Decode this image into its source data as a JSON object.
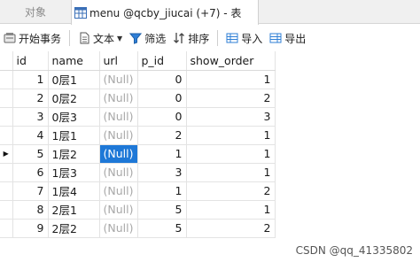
{
  "tabs": {
    "inactive_label": "对象",
    "active_label": "menu @qcby_jiucai (+7) - 表"
  },
  "toolbar": {
    "begin_transaction": "开始事务",
    "text": "文本",
    "filter": "筛选",
    "sort": "排序",
    "import": "导入",
    "export": "导出"
  },
  "columns": [
    "id",
    "name",
    "url",
    "p_id",
    "show_order"
  ],
  "rows": [
    {
      "id": "1",
      "name": "0层1",
      "url": "(Null)",
      "p_id": "0",
      "show_order": "1"
    },
    {
      "id": "2",
      "name": "0层2",
      "url": "(Null)",
      "p_id": "0",
      "show_order": "2"
    },
    {
      "id": "3",
      "name": "0层3",
      "url": "(Null)",
      "p_id": "0",
      "show_order": "3"
    },
    {
      "id": "4",
      "name": "1层1",
      "url": "(Null)",
      "p_id": "2",
      "show_order": "1"
    },
    {
      "id": "5",
      "name": "1层2",
      "url": "(Null)",
      "p_id": "1",
      "show_order": "1"
    },
    {
      "id": "6",
      "name": "1层3",
      "url": "(Null)",
      "p_id": "3",
      "show_order": "1"
    },
    {
      "id": "7",
      "name": "1层4",
      "url": "(Null)",
      "p_id": "1",
      "show_order": "2"
    },
    {
      "id": "8",
      "name": "2层1",
      "url": "(Null)",
      "p_id": "5",
      "show_order": "1"
    },
    {
      "id": "9",
      "name": "2层2",
      "url": "(Null)",
      "p_id": "5",
      "show_order": "2"
    }
  ],
  "current_row_marker": "▶",
  "watermark": "CSDN @qq_41335802",
  "colors": {
    "selection": "#1e78d7",
    "null_text": "#a8a8a8"
  }
}
